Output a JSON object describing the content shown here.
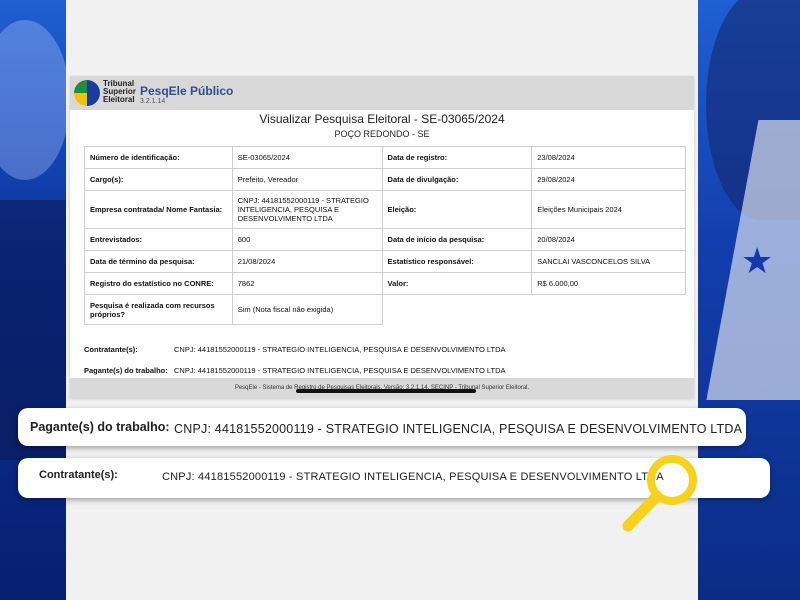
{
  "brand": {
    "org_lines": [
      "Tribunal",
      "Superior",
      "Eleitoral"
    ],
    "app_name": "PesqEle Público",
    "version": "3.2.1.14"
  },
  "document": {
    "title": "Visualizar Pesquisa Eleitoral - SE-03065/2024",
    "subtitle": "POÇO REDONDO - SE",
    "rows": [
      {
        "l1": "Número de identificação:",
        "v1": "SE-03065/2024",
        "l2": "Data de registro:",
        "v2": "23/08/2024"
      },
      {
        "l1": "Cargo(s):",
        "v1": "Prefeito, Vereador",
        "l2": "Data de divulgação:",
        "v2": "29/08/2024"
      },
      {
        "l1": "Empresa contratada/ Nome Fantasia:",
        "v1": "CNPJ: 44181552000119 - STRATEGIO INTELIGENCIA, PESQUISA E DESENVOLVIMENTO LTDA",
        "l2": "Eleição:",
        "v2": "Eleições Municipais 2024"
      },
      {
        "l1": "Entrevistados:",
        "v1": "600",
        "l2": "Data de início da pesquisa:",
        "v2": "20/08/2024"
      },
      {
        "l1": "Data de término da pesquisa:",
        "v1": "21/08/2024",
        "l2": "Estatístico responsável:",
        "v2": "SANCLAI VASCONCELOS SILVA"
      },
      {
        "l1": "Registro do estatístico no CONRE:",
        "v1": "7862",
        "l2": "Valor:",
        "v2": "R$ 6.000,00"
      },
      {
        "l1": "Pesquisa é realizada com recursos próprios?",
        "v1": "Sim (Nota fiscal não exigida)"
      }
    ],
    "contratante_label": "Contratante(s):",
    "contratante_value": "CNPJ: 44181552000119 - STRATEGIO INTELIGENCIA, PESQUISA E DESENVOLVIMENTO LTDA",
    "pagante_label": "Pagante(s) do trabalho:",
    "pagante_value": "CNPJ: 44181552000119 - STRATEGIO INTELIGENCIA, PESQUISA E DESENVOLVIMENTO LTDA",
    "footer": "PesqEle - Sistema de Registro de Pesquisas Eleitorais, Versão: 3.2.1.14, SECINP - Tribunal Superior Eleitoral."
  },
  "highlights": {
    "pagante_label": "Pagante(s) do trabalho:",
    "pagante_value": "CNPJ: 44181552000119 - STRATEGIO INTELIGENCIA, PESQUISA E DESENVOLVIMENTO LTDA",
    "contratante_label": "Contratante(s):",
    "contratante_value": "CNPJ: 44181552000119 - STRATEGIO INTELIGENCIA, PESQUISA E DESENVOLVIMENTO LTDA"
  },
  "colors": {
    "background_blue": "#0a2a8a",
    "magnifier_yellow": "#f6d21c",
    "brand_blue": "#2d4f8a"
  },
  "icons": {
    "magnifier": "magnifier-icon",
    "logo": "tse-logo-icon"
  }
}
